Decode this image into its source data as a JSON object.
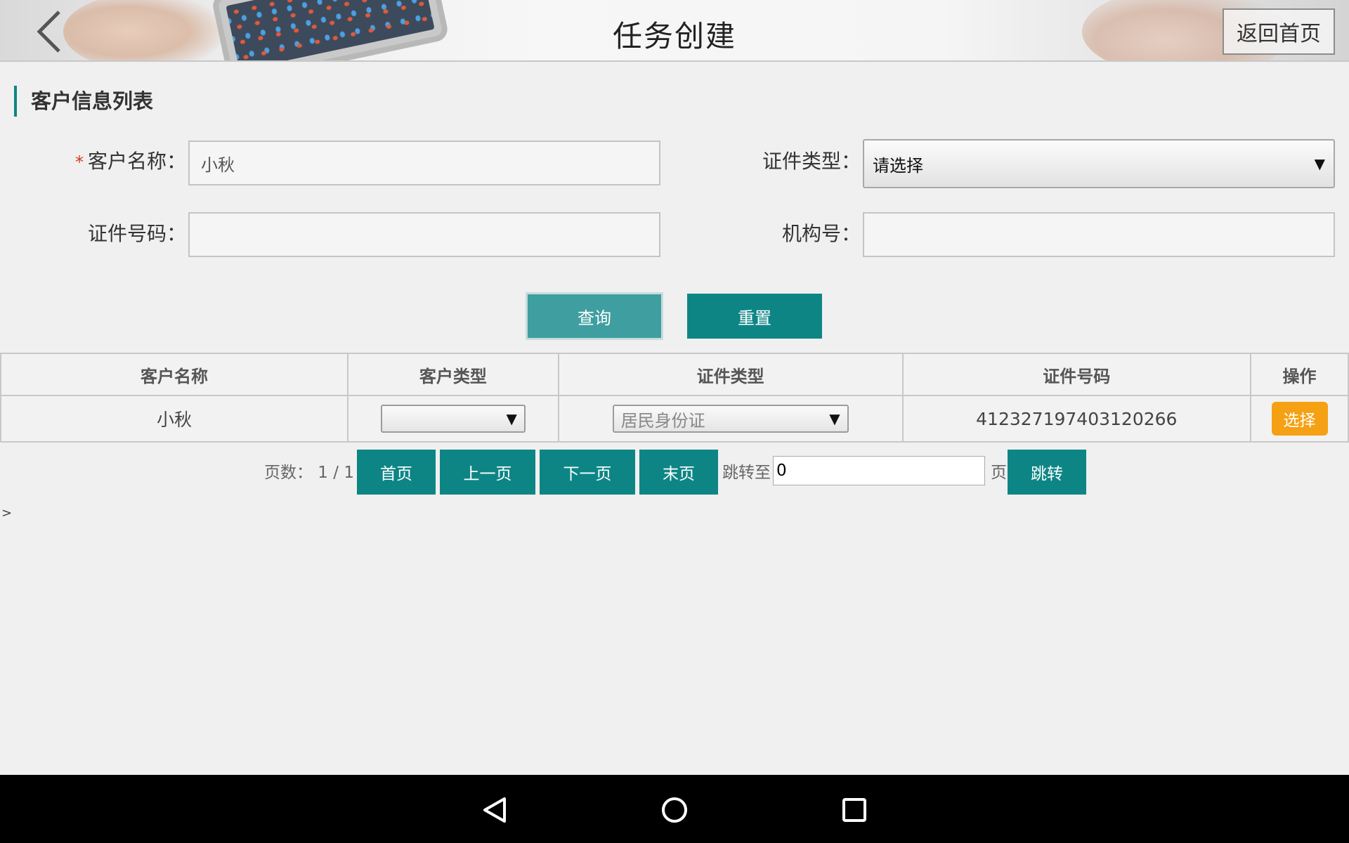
{
  "header": {
    "title": "任务创建",
    "home_button": "返回首页",
    "back_icon": "chevron-left-icon"
  },
  "section": {
    "title": "客户信息列表"
  },
  "form": {
    "required_mark": "*",
    "customer_name_label": "客户名称：",
    "customer_name_value": "小秋",
    "cert_type_label": "证件类型：",
    "cert_type_value": "请选择",
    "cert_no_label": "证件号码：",
    "cert_no_value": "",
    "org_no_label": "机构号：",
    "org_no_value": ""
  },
  "buttons": {
    "query": "查询",
    "reset": "重置"
  },
  "table": {
    "headers": [
      "客户名称",
      "客户类型",
      "证件类型",
      "证件号码",
      "操作"
    ],
    "rows": [
      {
        "name": "小秋",
        "customer_type": "",
        "cert_type": "居民身份证",
        "cert_no": "412327197403120266",
        "action": "选择"
      }
    ]
  },
  "pagination": {
    "page_info": "页数： 1 / 1",
    "first": "首页",
    "prev": "上一页",
    "next": "下一页",
    "last": "末页",
    "jump_to": "跳转至",
    "jump_value": "0",
    "page_suffix": "页",
    "jump": "跳转"
  },
  "stray_text": ">",
  "colors": {
    "accent": "#0e8585",
    "accent_light": "#3f9ea0",
    "action": "#f5a113",
    "required": "#d6381f"
  },
  "navbar": {
    "icons": [
      "back-triangle-icon",
      "home-circle-icon",
      "recents-square-icon"
    ]
  }
}
